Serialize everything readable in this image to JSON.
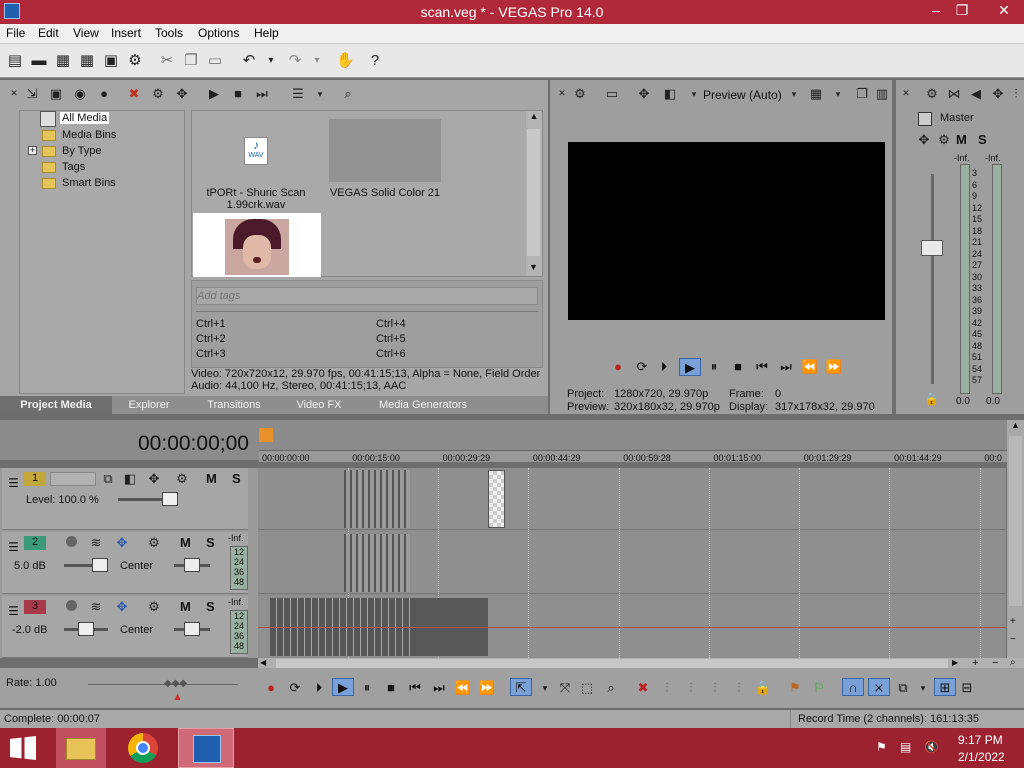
{
  "window": {
    "title": "scan.veg * - VEGAS Pro 14.0",
    "min": "‒",
    "max": "❐",
    "close": "✕"
  },
  "menu": [
    "File",
    "Edit",
    "View",
    "Insert",
    "Tools",
    "Options",
    "Help"
  ],
  "media": {
    "tree": [
      "All Media",
      "Media Bins",
      "By Type",
      "Tags",
      "Smart Bins"
    ],
    "expand": "+",
    "items": [
      {
        "name": "tPORt - Shuric Scan 1.99crk.wav",
        "badge": "WAV"
      },
      {
        "name": "VEGAS Solid Color 21"
      }
    ],
    "tags_placeholder": "Add tags",
    "shortcuts": [
      "Ctrl+1",
      "Ctrl+4",
      "Ctrl+2",
      "Ctrl+5",
      "Ctrl+3",
      "Ctrl+6"
    ],
    "info_video": "Video: 720x720x12, 29.970 fps, 00:41:15;13, Alpha = None, Field Order",
    "info_audio": "Audio: 44,100 Hz, Stereo, 00:41:15;13, AAC"
  },
  "tabs": [
    "Project Media",
    "Explorer",
    "Transitions",
    "Video FX",
    "Media Generators"
  ],
  "preview": {
    "mode": "Preview (Auto)",
    "project_label": "Project:",
    "project": "1280x720, 29.970p",
    "frame_label": "Frame:",
    "frame": "0",
    "preview_label": "Preview:",
    "preview": "320x180x32, 29.970p",
    "display_label": "Display:",
    "display": "317x178x32, 29.970"
  },
  "master": {
    "label": "Master",
    "inf_l": "-Inf.",
    "inf_r": "-Inf.",
    "scale": [
      "3",
      "6",
      "9",
      "12",
      "15",
      "18",
      "21",
      "24",
      "27",
      "30",
      "33",
      "36",
      "39",
      "42",
      "45",
      "48",
      "51",
      "54",
      "57"
    ],
    "val_l": "0.0",
    "val_r": "0.0"
  },
  "timeline": {
    "timecode": "00:00:00;00",
    "ruler": [
      "00:00:00:00",
      "00:00:15:00",
      "00:00:29:29",
      "00:00:44:29",
      "00:00:59:28",
      "00:01:15:00",
      "00:01:29:29",
      "00:01:44:29",
      "00:0"
    ],
    "tracks": [
      {
        "num": "1",
        "level": "Level: 100.0 %",
        "color": "#c2a83a"
      },
      {
        "num": "2",
        "db": "5.0 dB",
        "pan": "Center",
        "color": "#3a9a7a",
        "inf": "-Inf.",
        "vals": [
          "12",
          "24",
          "36",
          "48"
        ]
      },
      {
        "num": "3",
        "db": "-2.0 dB",
        "pan": "Center",
        "color": "#a83a4a",
        "inf": "-Inf.",
        "vals": [
          "12",
          "24",
          "36",
          "48"
        ]
      }
    ],
    "rate": "Rate: 1.00"
  },
  "status": {
    "left": "Complete: 00:00:07",
    "right": "Record Time (2 channels): 161:13:35"
  },
  "taskbar": {
    "time": "9:17 PM",
    "date": "2/1/2022"
  }
}
